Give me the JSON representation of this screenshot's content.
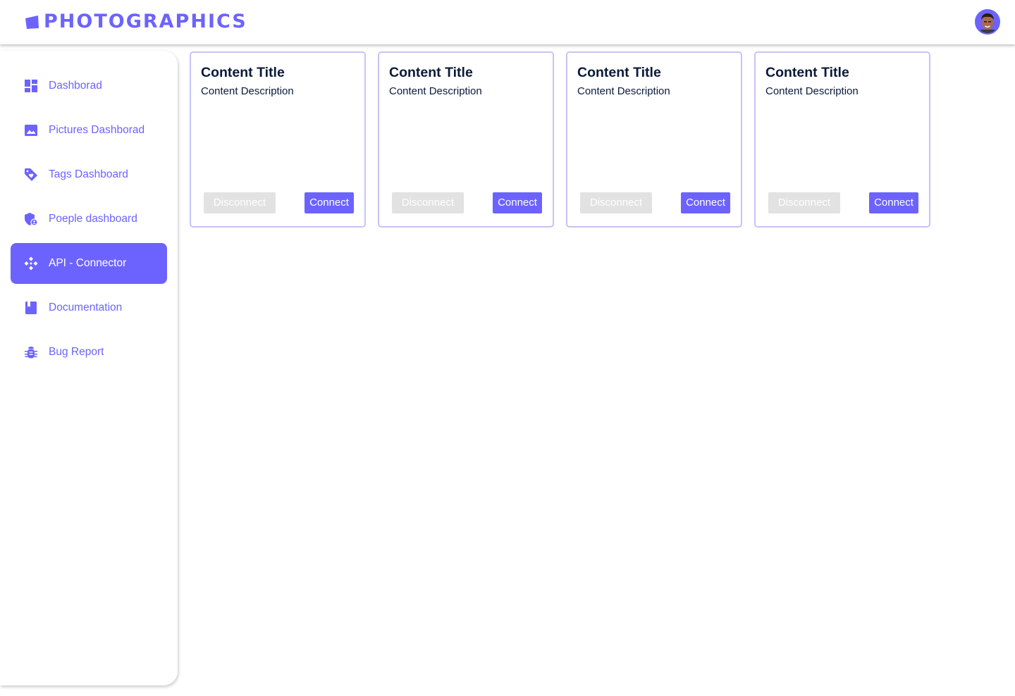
{
  "app": {
    "title": "PHOTOGRAPHICS",
    "logo_icon": "logo-mark-icon",
    "avatar_icon": "user-avatar"
  },
  "colors": {
    "accent": "#6c63ff",
    "card_border": "#c6c3f7",
    "text_dark": "#0a1a3a",
    "disabled": "#e2e2e2"
  },
  "sidebar": {
    "items": [
      {
        "label": "Dashborad",
        "icon": "dashboard-grid-icon",
        "active": false
      },
      {
        "label": "Pictures Dashborad",
        "icon": "image-icon",
        "active": false
      },
      {
        "label": "Tags Dashboard",
        "icon": "tag-heart-icon",
        "active": false
      },
      {
        "label": "Poeple dashboard",
        "icon": "shield-user-icon",
        "active": false
      },
      {
        "label": "API - Connector",
        "icon": "api-connector-icon",
        "active": true
      },
      {
        "label": "Documentation",
        "icon": "book-icon",
        "active": false
      },
      {
        "label": "Bug Report",
        "icon": "bug-icon",
        "active": false
      }
    ]
  },
  "cards": [
    {
      "title": "Content Title",
      "description": "Content Description",
      "disconnect_label": "Disconnect",
      "connect_label": "Connect"
    },
    {
      "title": "Content Title",
      "description": "Content Description",
      "disconnect_label": "Disconnect",
      "connect_label": "Connect"
    },
    {
      "title": "Content Title",
      "description": "Content Description",
      "disconnect_label": "Disconnect",
      "connect_label": "Connect"
    },
    {
      "title": "Content Title",
      "description": "Content Description",
      "disconnect_label": "Disconnect",
      "connect_label": "Connect"
    }
  ]
}
